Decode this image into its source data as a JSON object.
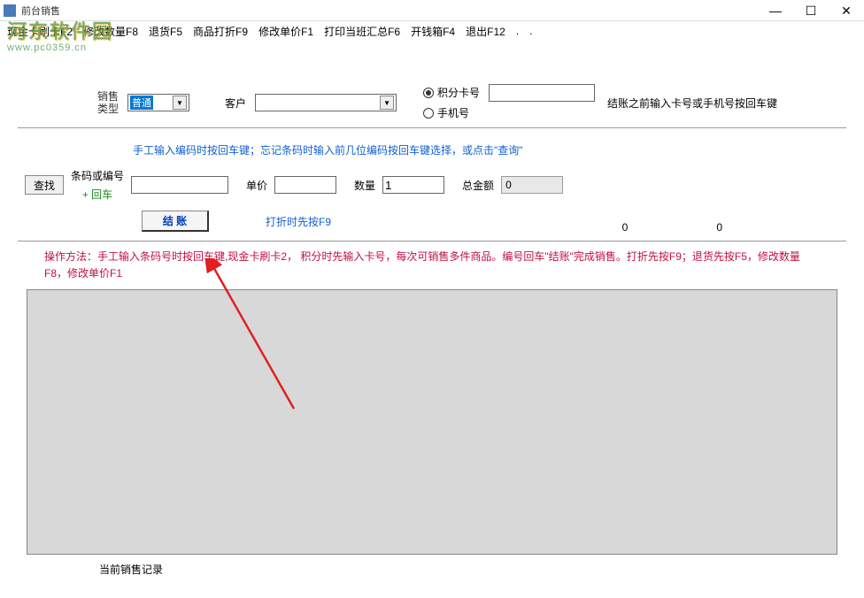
{
  "window": {
    "title": "前台销售",
    "minimize": "—",
    "maximize": "☐",
    "close": "✕"
  },
  "menubar": {
    "items": [
      "现金卡刷卡F2",
      "修改数量F8",
      "退货F5",
      "商品打折F9",
      "修改单价F1",
      "打印当班汇总F6",
      "开钱箱F4",
      "退出F12",
      ".",
      "."
    ]
  },
  "watermark": {
    "line1": "河东软件园",
    "line2": "www.pc0359.cn"
  },
  "form": {
    "sale_type_label1": "销售",
    "sale_type_label2": "类型",
    "sale_type_value": "普通",
    "customer_label": "客户",
    "radio_points": "积分卡号",
    "radio_phone": "手机号",
    "card_hint": "结账之前输入卡号或手机号按回车键",
    "barcode_hint": "手工输入编码时按回车键；忘记条码时输入前几位编码按回车键选择，或点击\"查询\"",
    "search_btn": "查找",
    "barcode_label": "条码或编号",
    "enter_label": "+ 回车",
    "price_label": "单价",
    "qty_label": "数量",
    "qty_value": "1",
    "total_label": "总金额",
    "total_value": "0",
    "checkout_btn": "结  账",
    "discount_hint": "打折时先按F9",
    "num1": "0",
    "num2": "0",
    "instruction": "操作方法：手工输入条码号时按回车键,现金卡刷卡2， 积分时先输入卡号，每次可销售多件商品。编号回车\"结账\"完成销售。打折先按F9；退货先按F5，修改数量F8，修改单价F1",
    "current_record": "当前销售记录"
  }
}
